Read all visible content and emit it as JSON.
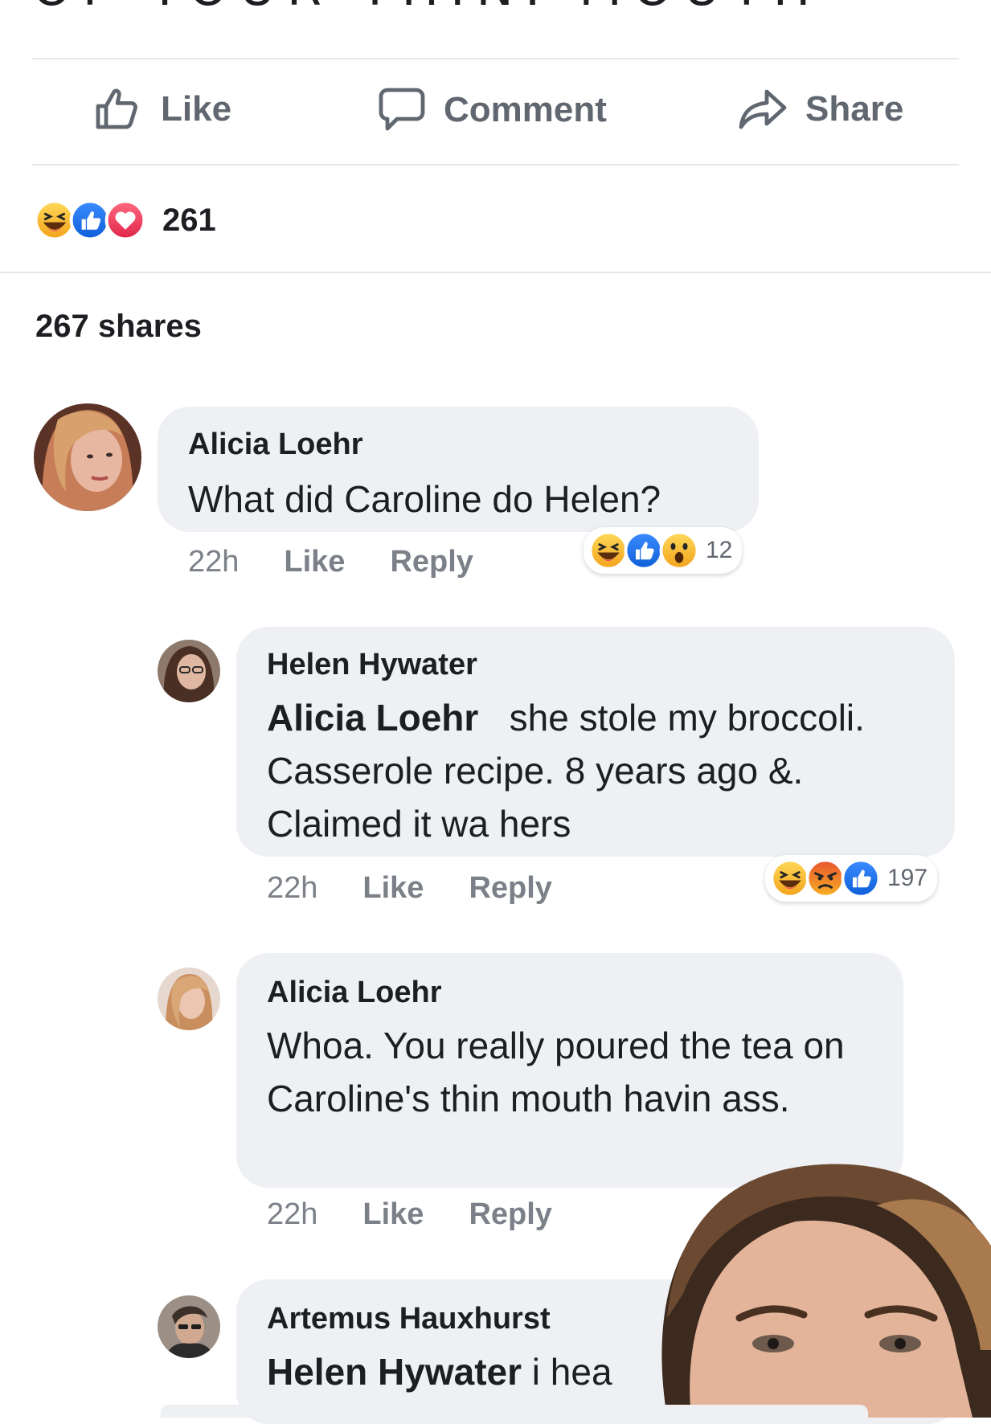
{
  "post": {
    "title_fragment": "OF YOUR THIN. MOUTH"
  },
  "actions": {
    "like_label": "Like",
    "comment_label": "Comment",
    "share_label": "Share"
  },
  "reactions": {
    "icons": [
      "haha-icon",
      "like-icon",
      "love-icon"
    ],
    "count": "261"
  },
  "shares": "267 shares",
  "comments": [
    {
      "author": "Alicia Loehr",
      "text": "What did Caroline do Helen?",
      "time": "22h",
      "like_label": "Like",
      "reply_label": "Reply",
      "reaction_icons": [
        "haha-icon",
        "like-icon",
        "wow-icon"
      ],
      "reaction_count": "12"
    },
    {
      "author": "Helen Hywater",
      "mention": "Alicia Loehr",
      "text": "she  stole  my broccoli. Casserole recipe. 8 years ago &. Claimed it wa hers",
      "time": "22h",
      "like_label": "Like",
      "reply_label": "Reply",
      "reaction_icons": [
        "haha-icon",
        "angry-icon",
        "like-icon"
      ],
      "reaction_count": "197"
    },
    {
      "author": "Alicia Loehr",
      "text": "Whoa. You really poured the tea on Caroline's thin mouth havin ass.",
      "time": "22h",
      "like_label": "Like",
      "reply_label": "Reply"
    },
    {
      "author": "Artemus Hauxhurst",
      "mention": "Helen Hywater",
      "text": "i hea"
    }
  ],
  "colors": {
    "bubble": "#eef0f4",
    "divider": "#e6e8eb",
    "meta_text": "#7b8089",
    "like_blue": "#1877f2",
    "love_red": "#f33e58",
    "haha_yellow": "#f7b125"
  }
}
